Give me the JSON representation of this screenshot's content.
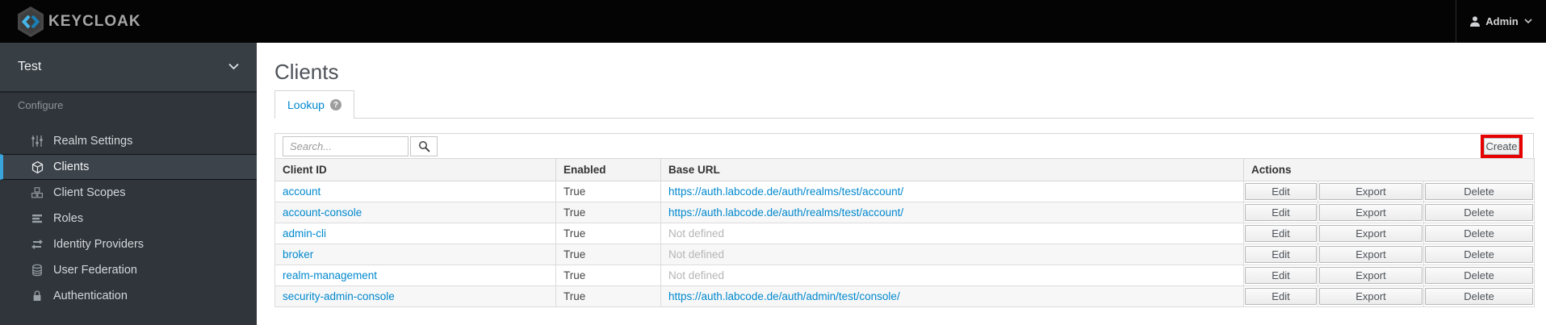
{
  "topbar": {
    "logo_text": "KEYCLOAK",
    "user_label": "Admin"
  },
  "sidebar": {
    "realm_name": "Test",
    "section_label": "Configure",
    "items": [
      {
        "label": "Realm Settings",
        "icon": "sliders-icon",
        "active": false
      },
      {
        "label": "Clients",
        "icon": "cube-icon",
        "active": true
      },
      {
        "label": "Client Scopes",
        "icon": "cubes-icon",
        "active": false
      },
      {
        "label": "Roles",
        "icon": "roles-icon",
        "active": false
      },
      {
        "label": "Identity Providers",
        "icon": "exchange-icon",
        "active": false
      },
      {
        "label": "User Federation",
        "icon": "database-icon",
        "active": false
      },
      {
        "label": "Authentication",
        "icon": "lock-icon",
        "active": false
      }
    ]
  },
  "main": {
    "title": "Clients",
    "tab_label": "Lookup",
    "help_glyph": "?",
    "toolbar": {
      "search_placeholder": "Search...",
      "create_label": "Create",
      "create_highlighted": true,
      "highlight_color": "#e60000"
    },
    "table": {
      "headers": [
        "Client ID",
        "Enabled",
        "Base URL",
        "Actions"
      ],
      "action_labels": [
        "Edit",
        "Export",
        "Delete"
      ],
      "rows": [
        {
          "client_id": "account",
          "enabled": "True",
          "base_url": "https://auth.labcode.de/auth/realms/test/account/",
          "base_url_is_link": true
        },
        {
          "client_id": "account-console",
          "enabled": "True",
          "base_url": "https://auth.labcode.de/auth/realms/test/account/",
          "base_url_is_link": true
        },
        {
          "client_id": "admin-cli",
          "enabled": "True",
          "base_url": "Not defined",
          "base_url_is_link": false
        },
        {
          "client_id": "broker",
          "enabled": "True",
          "base_url": "Not defined",
          "base_url_is_link": false
        },
        {
          "client_id": "realm-management",
          "enabled": "True",
          "base_url": "Not defined",
          "base_url_is_link": false
        },
        {
          "client_id": "security-admin-console",
          "enabled": "True",
          "base_url": "https://auth.labcode.de/auth/admin/test/console/",
          "base_url_is_link": true
        }
      ]
    }
  },
  "colors": {
    "accent_blue": "#0088ce",
    "sidebar_selected_bar": "#39a5dc",
    "highlight_red": "#e60000"
  }
}
